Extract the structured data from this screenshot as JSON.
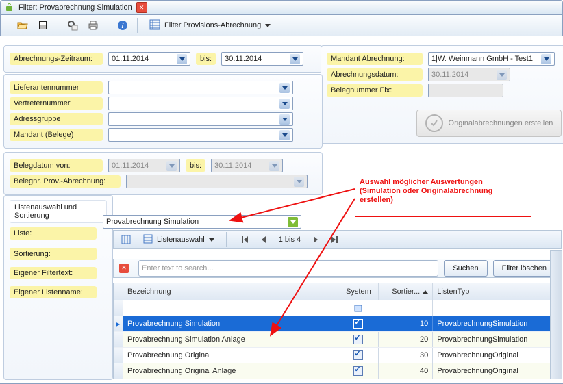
{
  "title": "Filter: Provabrechnung Simulation",
  "toolbar": {
    "dropdown_label": "Filter Provisions-Abrechnung"
  },
  "period": {
    "label": "Abrechnungs-Zeitraum:",
    "from": "01.11.2014",
    "bis_label": "bis:",
    "to": "30.11.2014"
  },
  "mandant": {
    "label": "Mandant Abrechnung:",
    "value": "1|W. Weinmann GmbH - Test1",
    "date_label": "Abrechnungsdatum:",
    "date_value": "30.11.2014",
    "beleg_label": "Belegnummer Fix:",
    "button_label": "Originalabrechnungen erstellen"
  },
  "filters": {
    "lieferant": "Lieferantennummer",
    "vertreter": "Vertreternummer",
    "adress": "Adressgruppe",
    "mandant_belege": "Mandant (Belege)"
  },
  "belegdatum": {
    "von_label": "Belegdatum von:",
    "von_value": "01.11.2014",
    "bis_label": "bis:",
    "bis_value": "30.11.2014",
    "belegnr_label": "Belegnr. Prov.-Abrechnung:"
  },
  "listen": {
    "header": "Listenauswahl und Sortierung",
    "liste_label": "Liste:",
    "liste_value": "Provabrechnung Simulation",
    "sortierung_label": "Sortierung:",
    "filtertext_label": "Eigener Filtertext:",
    "listenname_label": "Eigener Listenname:"
  },
  "grid_toolbar": {
    "dropdown_label": "Listenauswahl",
    "pager": "1 bis 4"
  },
  "search": {
    "placeholder": "Enter text to search...",
    "search_btn": "Suchen",
    "clear_btn": "Filter löschen"
  },
  "grid": {
    "columns": {
      "name": "Bezeichnung",
      "system": "System",
      "sort": "Sortier...",
      "type": "ListenTyp"
    },
    "rows": [
      {
        "name": "Provabrechnung Simulation",
        "system": true,
        "sort": "10",
        "type": "ProvabrechnungSimulation",
        "selected": true
      },
      {
        "name": "Provabrechnung Simulation Anlage",
        "system": true,
        "sort": "20",
        "type": "ProvabrechnungSimulation",
        "selected": false
      },
      {
        "name": "Provabrechnung Original",
        "system": true,
        "sort": "30",
        "type": "ProvabrechnungOriginal",
        "selected": false
      },
      {
        "name": "Provabrechnung Original Anlage",
        "system": true,
        "sort": "40",
        "type": "ProvabrechnungOriginal",
        "selected": false
      }
    ]
  },
  "callout": {
    "line1": "Auswahl möglicher Auswertungen",
    "line2": "(Simulation oder Originalabrechnung",
    "line3": "erstellen)"
  }
}
